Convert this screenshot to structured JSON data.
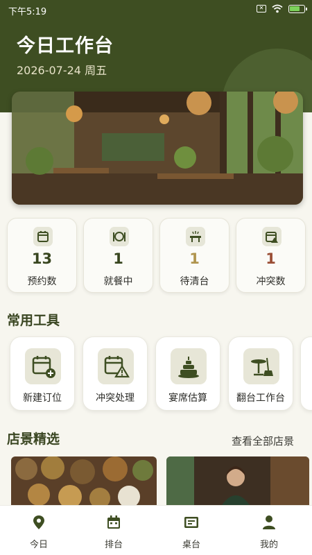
{
  "status_bar": {
    "time": "下午5:19",
    "icons": [
      "close-box-icon",
      "wifi-icon",
      "battery-icon"
    ]
  },
  "header": {
    "title": "今日工作台",
    "date": "2026-07-24 周五"
  },
  "colors": {
    "primary": "#3e4e22",
    "accent_gold": "#b0954e",
    "accent_rust": "#9a4e35"
  },
  "stats": [
    {
      "icon": "calendar-icon",
      "value": "13",
      "label": "预约数",
      "value_color": "#38461f"
    },
    {
      "icon": "dining-plate-icon",
      "value": "1",
      "label": "就餐中",
      "value_color": "#38461f"
    },
    {
      "icon": "table-cleaning-icon",
      "value": "1",
      "label": "待清台",
      "value_color": "#b0954e"
    },
    {
      "icon": "calendar-conflict-icon",
      "value": "1",
      "label": "冲突数",
      "value_color": "#9a4e35"
    }
  ],
  "tools_section": {
    "title": "常用工具",
    "items": [
      {
        "icon": "calendar-add-icon",
        "label": "新建订位"
      },
      {
        "icon": "calendar-warning-icon",
        "label": "冲突处理"
      },
      {
        "icon": "banquet-cake-icon",
        "label": "宴席估算"
      },
      {
        "icon": "table-broom-icon",
        "label": "翻台工作台"
      }
    ]
  },
  "featured_section": {
    "title": "店景精选",
    "view_all": "查看全部店景"
  },
  "tabbar": {
    "items": [
      {
        "icon": "location-pin-icon",
        "label": "今日"
      },
      {
        "icon": "calendar-icon",
        "label": "排台"
      },
      {
        "icon": "table-card-icon",
        "label": "桌台"
      },
      {
        "icon": "user-icon",
        "label": "我的"
      }
    ]
  }
}
